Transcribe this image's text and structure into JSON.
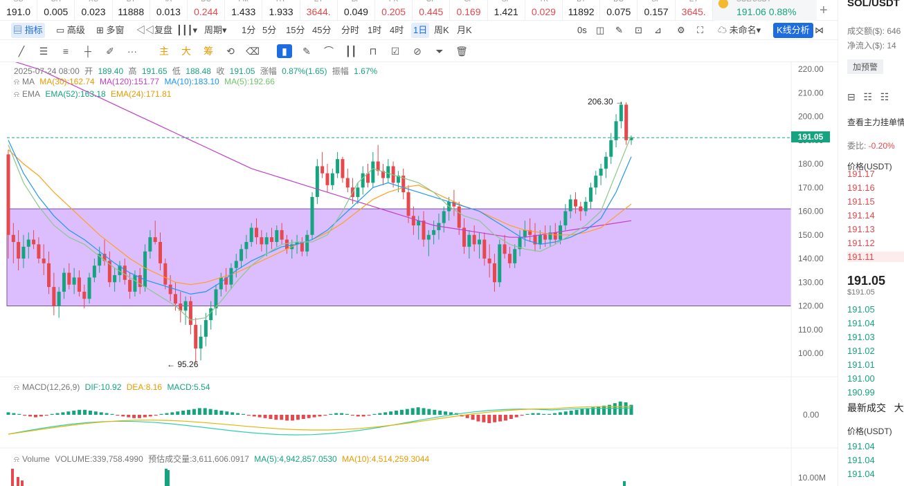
{
  "tickers": [
    {
      "sym": "SC",
      "val": "191.0",
      "dir": "neutral"
    },
    {
      "sym": "CH",
      "val": "0.005",
      "dir": "neutral"
    },
    {
      "sym": "XC",
      "val": "0.023",
      "dir": "neutral"
    },
    {
      "sym": "BT",
      "val": "11888",
      "dir": "neutral"
    },
    {
      "sym": "IA",
      "val": "0.013",
      "dir": "neutral"
    },
    {
      "sym": "DC",
      "val": "0.244",
      "dir": "down"
    },
    {
      "sym": "FM",
      "val": "1.433",
      "dir": "neutral"
    },
    {
      "sym": "HY",
      "val": "1.933",
      "dir": "neutral"
    },
    {
      "sym": "ET",
      "val": "3644.",
      "dir": "down"
    },
    {
      "sym": "BP",
      "val": "0.049",
      "dir": "neutral"
    },
    {
      "sym": "PK",
      "val": "0.205",
      "dir": "down"
    },
    {
      "sym": "GP",
      "val": "0.445",
      "dir": "down"
    },
    {
      "sym": "CF",
      "val": "0.169",
      "dir": "down"
    },
    {
      "sym": "SF",
      "val": "1.421",
      "dir": "neutral"
    },
    {
      "sym": "TK",
      "val": "0.029",
      "dir": "down"
    },
    {
      "sym": "BT",
      "val": "11892",
      "dir": "neutral"
    },
    {
      "sym": "DO",
      "val": "0.075",
      "dir": "neutral"
    },
    {
      "sym": "SP",
      "val": "0.157",
      "dir": "neutral"
    },
    {
      "sym": "ET",
      "val": "3645.",
      "dir": "down"
    }
  ],
  "active_ticker": {
    "sym": "SOL/USDT",
    "price": "191.06",
    "change": "0.88%"
  },
  "toolbar": {
    "indicators": "指标",
    "advanced": "高级",
    "multiwindow": "多窗",
    "replay": "复盘",
    "period": "周期",
    "intervals": [
      "1分",
      "5分",
      "15分",
      "45分",
      "分时",
      "1时",
      "4时",
      "1日",
      "周K",
      "月K"
    ],
    "active_interval": "1日",
    "countdown": "0s",
    "unnamed": "未命名",
    "kline_analysis": "K线分析"
  },
  "drawtools": {
    "main": "主",
    "big": "大",
    "chip": "筹"
  },
  "ohlc_line": {
    "date": "2025-07-24 08:00",
    "open_label": "开",
    "open": "189.40",
    "high_label": "高",
    "high": "191.65",
    "low_label": "低",
    "low": "188.48",
    "close_label": "收",
    "close": "191.05",
    "chg_label": "涨幅",
    "chg": "0.87%(1.65)",
    "amp_label": "振幅",
    "amp": "1.67%"
  },
  "ma_line": {
    "name": "MA",
    "ma30": "MA(30):162.74",
    "ma120": "MA(120):151.77",
    "ma10": "MA(10):183.10",
    "ma5": "MA(5):192.66"
  },
  "ema_line": {
    "name": "EMA",
    "ema52": "EMA(52):163.18",
    "ema24": "EMA(24):171.81"
  },
  "macd_line": {
    "name": "MACD(12,26,9)",
    "dif": "DIF:10.92",
    "dea": "DEA:8.16",
    "macd": "MACD:5.54"
  },
  "vol_line": {
    "name": "Volume",
    "volume": "VOLUME:339,758.4990",
    "est": "预估成交量:3,611,606.0917",
    "ma5": "MA(5):4,942,857.0530",
    "ma10": "MA(10):4,514,259.3044"
  },
  "annotations": {
    "high": "206.30",
    "low": "95.26"
  },
  "current_price_tag": "191.05",
  "macd_zero": "0.00",
  "vol_axis": "10.00M",
  "colors": {
    "up": "#16a37f",
    "down": "#e5484d",
    "zone": "#d9b8ff",
    "ma5": "#8ac78a",
    "ma10": "#2196f3",
    "ma30": "#ff9f1c",
    "ma120": "#c23fc9",
    "dif": "#2ecfb0",
    "dea": "#e8b400"
  },
  "chart_data": {
    "type": "candlestick",
    "y_axis_ticks": [
      220,
      210,
      200,
      190,
      180,
      170,
      160,
      150,
      140,
      130,
      120,
      110,
      100
    ],
    "ylim": [
      93,
      224
    ],
    "highlight_zone": [
      120,
      161
    ],
    "candles": [
      [
        184,
        186,
        140,
        150
      ],
      [
        150,
        155,
        138,
        147
      ],
      [
        147,
        152,
        135,
        140
      ],
      [
        140,
        150,
        136,
        145
      ],
      [
        145,
        151,
        140,
        148
      ],
      [
        148,
        152,
        144,
        146
      ],
      [
        146,
        149,
        138,
        140
      ],
      [
        140,
        146,
        133,
        138
      ],
      [
        138,
        143,
        125,
        128
      ],
      [
        128,
        134,
        116,
        120
      ],
      [
        120,
        128,
        115,
        126
      ],
      [
        126,
        136,
        123,
        134
      ],
      [
        134,
        138,
        127,
        129
      ],
      [
        129,
        136,
        125,
        132
      ],
      [
        132,
        135,
        124,
        126
      ],
      [
        126,
        129,
        119,
        123
      ],
      [
        123,
        134,
        121,
        132
      ],
      [
        132,
        140,
        130,
        137
      ],
      [
        137,
        145,
        134,
        142
      ],
      [
        142,
        148,
        137,
        139
      ],
      [
        139,
        143,
        128,
        130
      ],
      [
        130,
        136,
        126,
        133
      ],
      [
        133,
        139,
        130,
        137
      ],
      [
        137,
        140,
        129,
        131
      ],
      [
        131,
        134,
        123,
        126
      ],
      [
        126,
        135,
        124,
        133
      ],
      [
        133,
        136,
        125,
        128
      ],
      [
        128,
        146,
        126,
        143
      ],
      [
        143,
        152,
        140,
        149
      ],
      [
        149,
        156,
        146,
        147
      ],
      [
        147,
        151,
        135,
        138
      ],
      [
        138,
        140,
        127,
        129
      ],
      [
        129,
        133,
        122,
        125
      ],
      [
        125,
        130,
        118,
        121
      ],
      [
        121,
        126,
        113,
        118
      ],
      [
        118,
        124,
        112,
        122
      ],
      [
        122,
        124,
        108,
        112
      ],
      [
        112,
        115,
        96,
        102
      ],
      [
        102,
        112,
        97,
        107
      ],
      [
        107,
        117,
        103,
        114
      ],
      [
        114,
        122,
        110,
        119
      ],
      [
        119,
        129,
        116,
        127
      ],
      [
        127,
        134,
        124,
        132
      ],
      [
        132,
        136,
        126,
        129
      ],
      [
        129,
        138,
        127,
        136
      ],
      [
        136,
        142,
        132,
        139
      ],
      [
        139,
        146,
        136,
        144
      ],
      [
        144,
        150,
        140,
        147
      ],
      [
        147,
        155,
        145,
        153
      ],
      [
        153,
        157,
        146,
        149
      ],
      [
        149,
        152,
        143,
        146
      ],
      [
        146,
        151,
        141,
        149
      ],
      [
        149,
        153,
        144,
        147
      ],
      [
        147,
        154,
        145,
        152
      ],
      [
        152,
        155,
        146,
        148
      ],
      [
        148,
        150,
        142,
        144
      ],
      [
        144,
        148,
        140,
        146
      ],
      [
        146,
        150,
        142,
        147
      ],
      [
        147,
        149,
        141,
        143
      ],
      [
        143,
        152,
        141,
        150
      ],
      [
        150,
        168,
        148,
        166
      ],
      [
        166,
        182,
        163,
        179
      ],
      [
        179,
        185,
        174,
        176
      ],
      [
        176,
        180,
        168,
        171
      ],
      [
        171,
        178,
        169,
        176
      ],
      [
        176,
        185,
        174,
        182
      ],
      [
        182,
        183,
        172,
        174
      ],
      [
        174,
        178,
        168,
        170
      ],
      [
        170,
        174,
        163,
        166
      ],
      [
        166,
        172,
        163,
        170
      ],
      [
        170,
        179,
        167,
        176
      ],
      [
        176,
        180,
        170,
        172
      ],
      [
        172,
        185,
        170,
        181
      ],
      [
        181,
        188,
        175,
        177
      ],
      [
        177,
        180,
        171,
        174
      ],
      [
        174,
        182,
        172,
        179
      ],
      [
        179,
        181,
        170,
        172
      ],
      [
        172,
        177,
        168,
        175
      ],
      [
        175,
        178,
        165,
        168
      ],
      [
        168,
        171,
        155,
        158
      ],
      [
        158,
        162,
        150,
        154
      ],
      [
        154,
        158,
        148,
        156
      ],
      [
        156,
        160,
        145,
        148
      ],
      [
        148,
        152,
        141,
        150
      ],
      [
        150,
        156,
        146,
        152
      ],
      [
        152,
        159,
        148,
        155
      ],
      [
        155,
        162,
        151,
        160
      ],
      [
        160,
        166,
        156,
        164
      ],
      [
        164,
        169,
        158,
        162
      ],
      [
        162,
        164,
        150,
        153
      ],
      [
        153,
        157,
        142,
        145
      ],
      [
        145,
        152,
        140,
        150
      ],
      [
        150,
        154,
        143,
        146
      ],
      [
        146,
        151,
        140,
        148
      ],
      [
        148,
        151,
        137,
        140
      ],
      [
        140,
        146,
        132,
        138
      ],
      [
        138,
        142,
        126,
        130
      ],
      [
        130,
        148,
        128,
        146
      ],
      [
        146,
        150,
        140,
        142
      ],
      [
        142,
        145,
        136,
        138
      ],
      [
        138,
        146,
        136,
        144
      ],
      [
        144,
        152,
        141,
        149
      ],
      [
        149,
        156,
        145,
        152
      ],
      [
        152,
        157,
        147,
        150
      ],
      [
        150,
        155,
        143,
        146
      ],
      [
        146,
        152,
        144,
        150
      ],
      [
        150,
        154,
        145,
        148
      ],
      [
        148,
        154,
        145,
        151
      ],
      [
        151,
        155,
        146,
        148
      ],
      [
        148,
        156,
        146,
        154
      ],
      [
        154,
        163,
        152,
        160
      ],
      [
        160,
        167,
        157,
        165
      ],
      [
        165,
        168,
        159,
        162
      ],
      [
        162,
        164,
        156,
        160
      ],
      [
        160,
        166,
        158,
        164
      ],
      [
        164,
        172,
        161,
        170
      ],
      [
        170,
        177,
        167,
        175
      ],
      [
        175,
        180,
        171,
        178
      ],
      [
        178,
        185,
        174,
        183
      ],
      [
        183,
        193,
        180,
        190
      ],
      [
        190,
        201,
        187,
        198
      ],
      [
        198,
        206.3,
        195,
        205
      ],
      [
        205,
        206,
        188,
        190
      ],
      [
        190,
        192,
        188,
        191.05
      ]
    ],
    "ma120": [
      224,
      222,
      220,
      217,
      214,
      211,
      208,
      205,
      202,
      199,
      196,
      193,
      190,
      187,
      184,
      181,
      178,
      176,
      174,
      172,
      170,
      168,
      166,
      164,
      162,
      160,
      158,
      156,
      154,
      153,
      152,
      151,
      150,
      149,
      149,
      150,
      151,
      152,
      153,
      154,
      155,
      156
    ],
    "ma30": [
      186,
      180,
      175,
      168,
      162,
      156,
      150,
      145,
      140,
      136,
      133,
      130,
      129,
      130,
      132,
      134,
      137,
      140,
      143,
      146,
      148,
      151,
      155,
      160,
      165,
      168,
      170,
      171,
      168,
      165,
      162,
      160,
      157,
      154,
      152,
      151,
      150,
      150,
      151,
      153,
      158,
      163
    ],
    "ma10": [
      190,
      176,
      166,
      158,
      152,
      148,
      143,
      138,
      134,
      131,
      129,
      127,
      125,
      126,
      130,
      135,
      139,
      142,
      145,
      146,
      148,
      152,
      158,
      164,
      170,
      172,
      170,
      168,
      166,
      164,
      162,
      160,
      156,
      152,
      148,
      146,
      147,
      149,
      152,
      157,
      168,
      183
    ],
    "ma5": [
      188,
      172,
      162,
      154,
      149,
      146,
      141,
      136,
      132,
      128,
      124,
      120,
      114,
      115,
      122,
      130,
      137,
      142,
      146,
      147,
      147,
      150,
      160,
      172,
      178,
      176,
      174,
      172,
      168,
      162,
      158,
      156,
      150,
      146,
      144,
      143,
      146,
      150,
      154,
      160,
      176,
      192
    ]
  }
}
